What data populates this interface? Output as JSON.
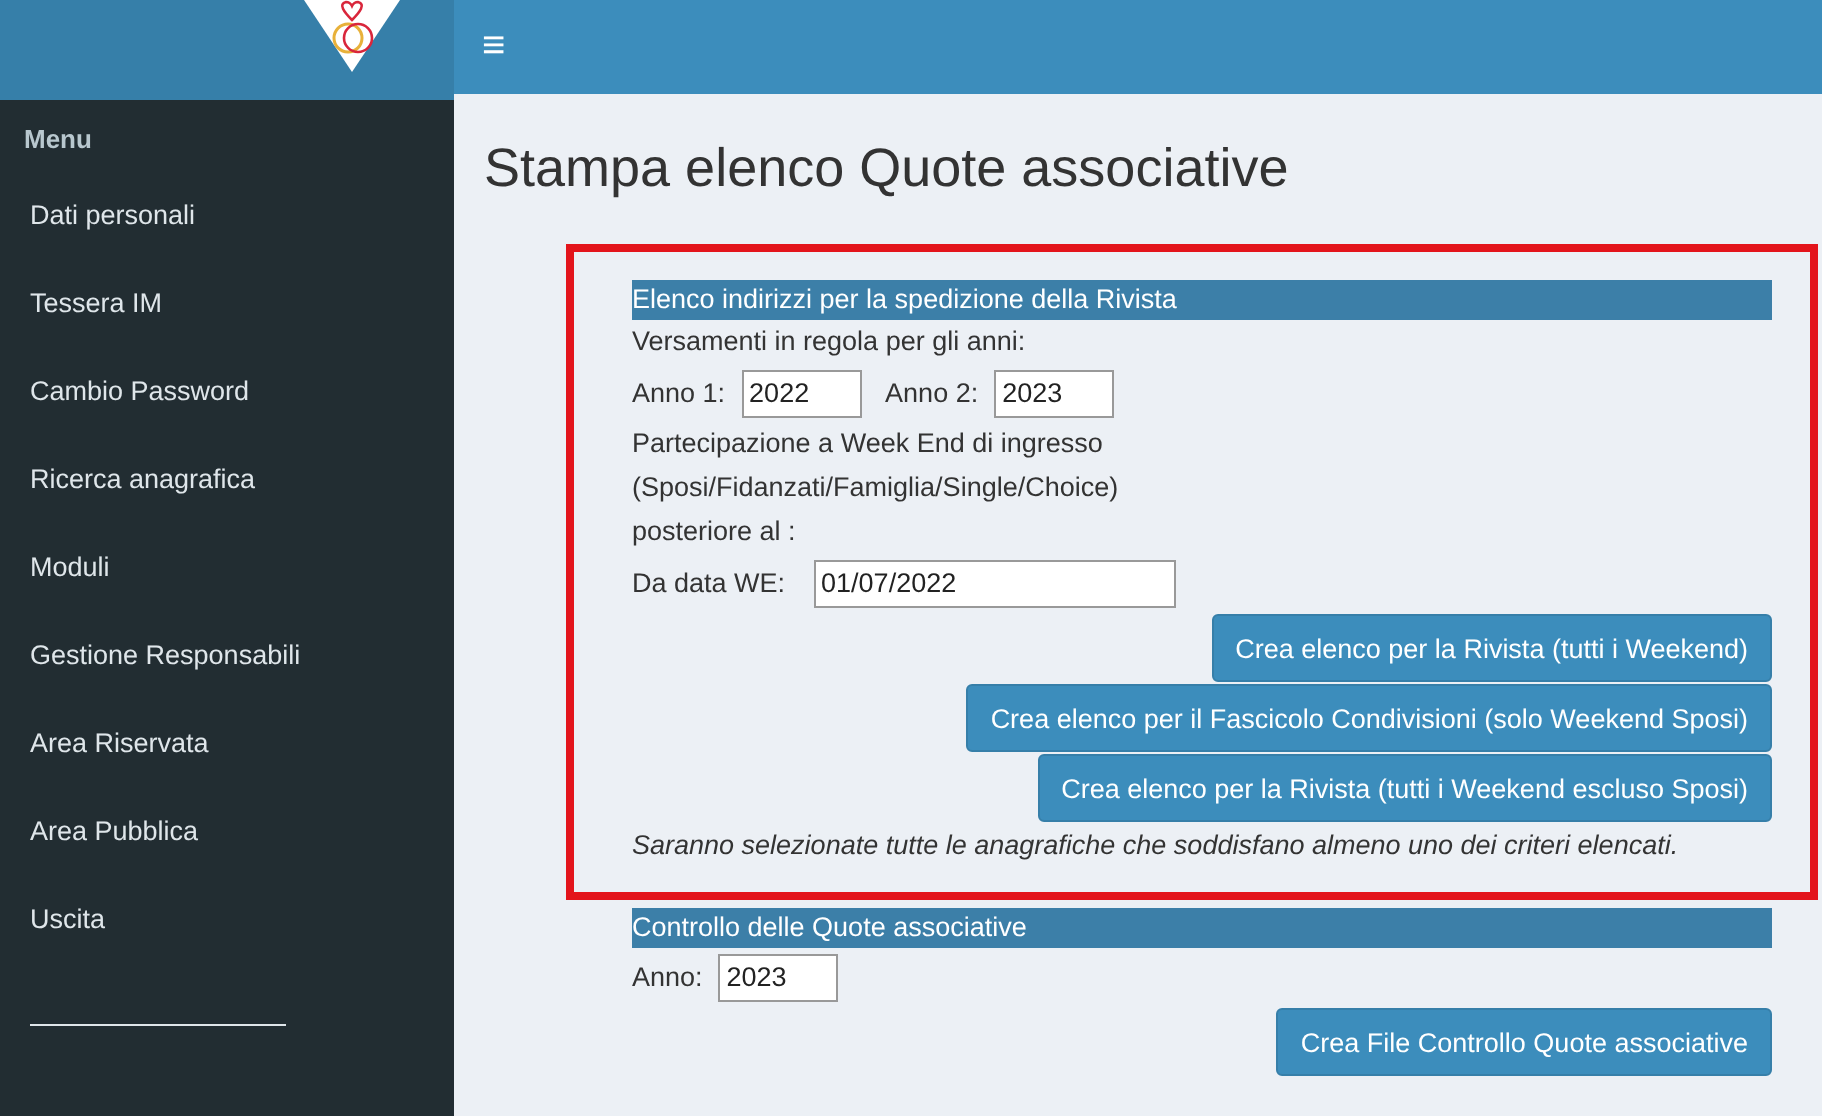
{
  "sidebar": {
    "heading": "Menu",
    "items": [
      {
        "label": "Dati personali"
      },
      {
        "label": "Tessera IM"
      },
      {
        "label": "Cambio Password"
      },
      {
        "label": "Ricerca anagrafica"
      },
      {
        "label": "Moduli"
      },
      {
        "label": "Gestione Responsabili"
      },
      {
        "label": "Area Riservata"
      },
      {
        "label": "Area Pubblica"
      },
      {
        "label": "Uscita"
      }
    ]
  },
  "header": {
    "menu_toggle": "≡"
  },
  "page_title": "Stampa elenco Quote associative",
  "sections": [
    {
      "title": "Elenco indirizzi per la spedizione della Rivista",
      "highlighted": true,
      "rows": [
        {
          "kind": "text",
          "text": "Versamenti in regola per gli anni:"
        },
        {
          "kind": "fields",
          "fields": [
            {
              "label": "Anno 1:",
              "value": "2022",
              "kind": "year"
            },
            {
              "label": "Anno 2:",
              "value": "2023",
              "kind": "year"
            }
          ]
        },
        {
          "kind": "text",
          "text": "Partecipazione a Week End di ingresso"
        },
        {
          "kind": "text",
          "text": "(Sposi/Fidanzati/Famiglia/Single/Choice)"
        },
        {
          "kind": "text",
          "text": "posteriore al :"
        },
        {
          "kind": "fields",
          "fields": [
            {
              "label": "Da data WE:",
              "value": "01/07/2022",
              "kind": "date"
            }
          ]
        },
        {
          "kind": "button",
          "label": "Crea elenco per la Rivista (tutti i Weekend)"
        },
        {
          "kind": "button",
          "label": "Crea elenco per il Fascicolo Condivisioni (solo Weekend Sposi)"
        },
        {
          "kind": "button",
          "label": "Crea elenco per la Rivista (tutti i Weekend escluso Sposi)"
        },
        {
          "kind": "note",
          "text": "Saranno selezionate tutte le anagrafiche che soddisfano almeno uno dei criteri elencati."
        }
      ]
    },
    {
      "title": "Controllo delle Quote associative",
      "highlighted": false,
      "rows": [
        {
          "kind": "fields",
          "fields": [
            {
              "label": "Anno:",
              "value": "2023",
              "kind": "year"
            }
          ]
        },
        {
          "kind": "button",
          "label": "Crea File Controllo Quote associative"
        }
      ]
    }
  ]
}
